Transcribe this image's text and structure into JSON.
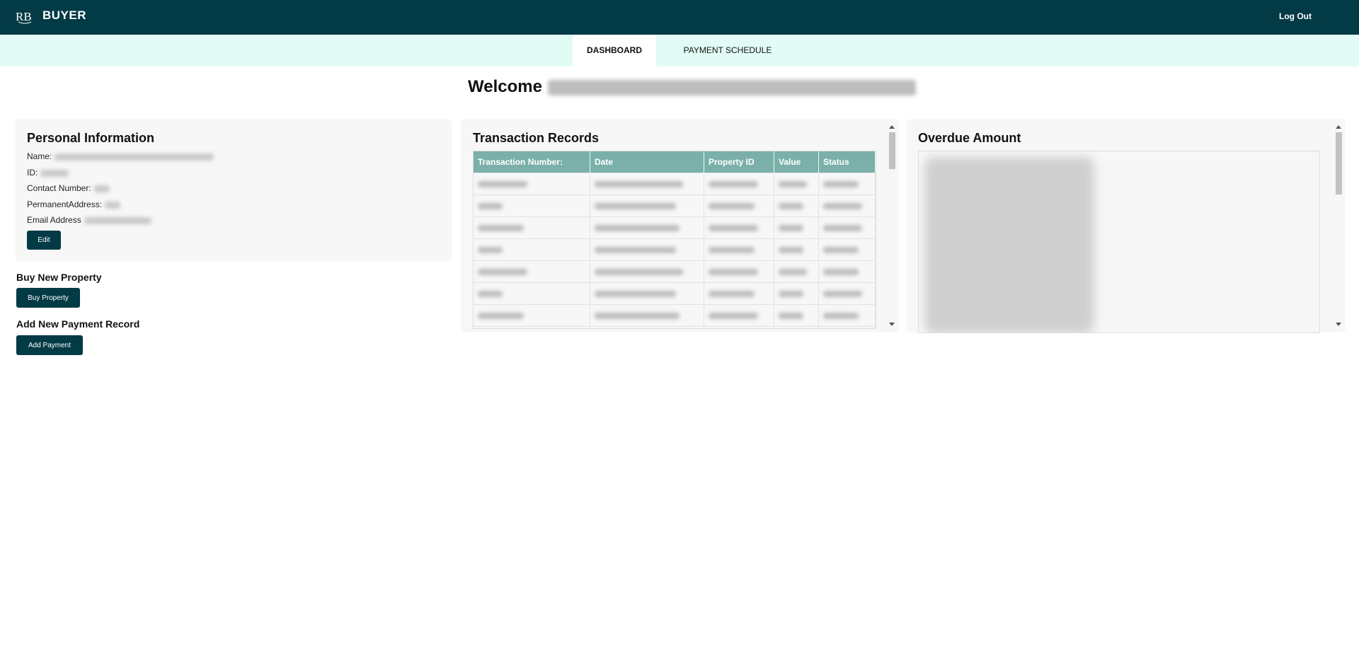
{
  "header": {
    "brand": "BUYER",
    "logo_text": "RB",
    "logout_label": "Log Out"
  },
  "tabs": [
    {
      "label": "DASHBOARD",
      "active": true
    },
    {
      "label": "PAYMENT SCHEDULE",
      "active": false
    }
  ],
  "welcome": {
    "prefix": "Welcome"
  },
  "personal": {
    "title": "Personal Information",
    "name_label": "Name:",
    "id_label": "ID:",
    "contact_label": "Contact Number:",
    "address_label": "PermanentAddress:",
    "email_label": "Email Address",
    "edit_label": "Edit"
  },
  "buy": {
    "title": "Buy New Property",
    "button": "Buy Property"
  },
  "payment": {
    "title": "Add New Payment Record",
    "button": "Add Payment"
  },
  "transactions": {
    "title": "Transaction Records",
    "columns": [
      "Transaction Number:",
      "Date",
      "Property ID",
      "Value",
      "Status"
    ]
  },
  "overdue": {
    "title": "Overdue Amount"
  },
  "colors": {
    "primary": "#023a45",
    "tab_bar": "#e2fcf5",
    "table_header": "#7ab0a9"
  },
  "icons": {
    "logo": "rb-logo-icon",
    "scroll_up": "chevron-up-icon",
    "scroll_down": "chevron-down-icon"
  }
}
